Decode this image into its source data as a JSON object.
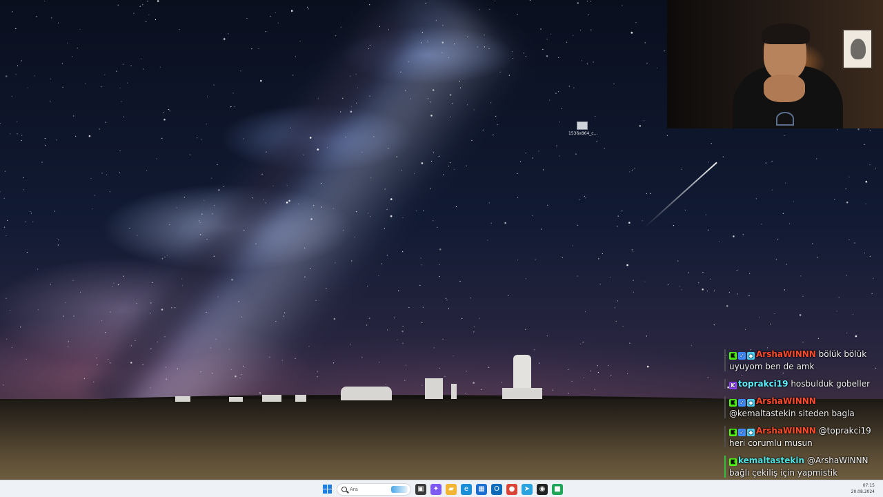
{
  "desktop": {
    "icons": [
      {
        "label": "1536x864_c...",
        "icon": "image-file-icon"
      }
    ]
  },
  "webcam": {
    "icon": "webcam-feed"
  },
  "chat": {
    "messages": [
      {
        "badges": [
          "kick-badge",
          "verified-badge",
          "crystal-badge"
        ],
        "user": "ArshaWINNN",
        "user_color": "#ff4b2b",
        "text": "bölük bölük uyuyom ben de amk",
        "accent": "gray"
      },
      {
        "badges": [
          "kick-purple-badge"
        ],
        "user": "toprakci19",
        "user_color": "#5bf0ff",
        "text": "hosbulduk gobeller",
        "accent": "gray"
      },
      {
        "badges": [
          "kick-badge",
          "verified-badge",
          "crystal-badge"
        ],
        "user": "ArshaWINNN",
        "user_color": "#ff4b2b",
        "text": "@kemaltastekin siteden bagla",
        "accent": "gray"
      },
      {
        "badges": [
          "kick-badge",
          "verified-badge",
          "crystal-badge"
        ],
        "user": "ArshaWINNN",
        "user_color": "#ff4b2b",
        "text": "@toprakci19 heri corumlu musun",
        "accent": "gray"
      },
      {
        "badges": [
          "kick-badge"
        ],
        "user": "kemaltastekin",
        "user_color": "#4fe3e3",
        "text": "@ArshaWINNN bağlı çekiliş için yapmistik",
        "accent": "green"
      }
    ]
  },
  "taskbar": {
    "search_placeholder": "Ara",
    "apps": [
      {
        "name": "file-explorer-icon",
        "color": "#3a3a3a"
      },
      {
        "name": "copilot-icon",
        "color": "#7f5af0"
      },
      {
        "name": "folder-icon",
        "color": "#f2b632"
      },
      {
        "name": "edge-icon",
        "color": "#1a8fd8"
      },
      {
        "name": "store-icon",
        "color": "#1c6fd1"
      },
      {
        "name": "outlook-icon",
        "color": "#0f6cbd"
      },
      {
        "name": "chrome-icon",
        "color": "#db4437"
      },
      {
        "name": "telegram-icon",
        "color": "#2aa3df"
      },
      {
        "name": "obs-icon",
        "color": "#222222"
      },
      {
        "name": "app-green-icon",
        "color": "#21a65a"
      }
    ],
    "clock_time": "07:15",
    "clock_date": "20.08.2024"
  }
}
